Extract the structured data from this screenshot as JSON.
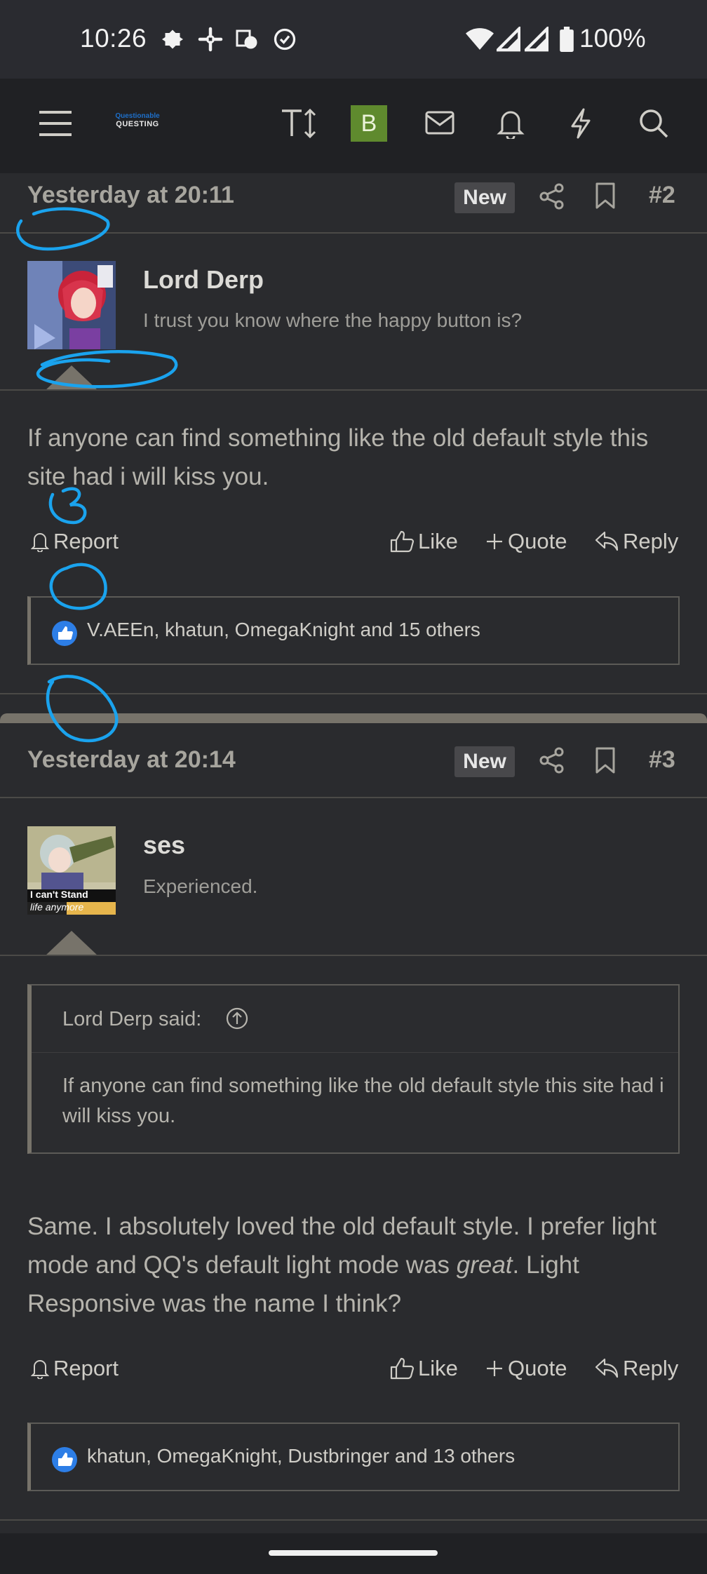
{
  "status_bar": {
    "time": "10:26",
    "battery": "100%"
  },
  "nav": {
    "logo_line1": "Questionable",
    "logo_line2": "QUESTING",
    "badge": "B"
  },
  "posts": [
    {
      "date": "Yesterday at 20:11",
      "new_label": "New",
      "number": "#2",
      "username": "Lord Derp",
      "user_title": "I trust you know where the happy button is?",
      "body": "If anyone can find something like the old default style this site had i will kiss you.",
      "actions": {
        "report": "Report",
        "like": "Like",
        "quote": "Quote",
        "reply": "Reply"
      },
      "reactions": "V.AEEn, khatun, OmegaKnight and 15 others"
    },
    {
      "date": "Yesterday at 20:14",
      "new_label": "New",
      "number": "#3",
      "username": "ses",
      "user_title": "Experienced.",
      "avatar_caption_1": "I can't Stand",
      "avatar_caption_2": "life anymore",
      "quote_author": "Lord Derp said:",
      "quote_text": "If anyone can find something like the old default style this site had i will kiss you.",
      "body_1": "Same. I absolutely loved the old default style. I prefer light mode and QQ's default light mode was ",
      "body_em": "great",
      "body_2": ". Light Responsive was the name I think?",
      "actions": {
        "report": "Report",
        "like": "Like",
        "quote": "Quote",
        "reply": "Reply"
      },
      "reactions": "khatun, OmegaKnight, Dustbringer and 13 others"
    }
  ],
  "colors": {
    "background": "#2a2b2e",
    "accent_annotation": "#1aa3ee",
    "like_blue": "#2d7ee6",
    "badge_green": "#5f8a2e"
  }
}
